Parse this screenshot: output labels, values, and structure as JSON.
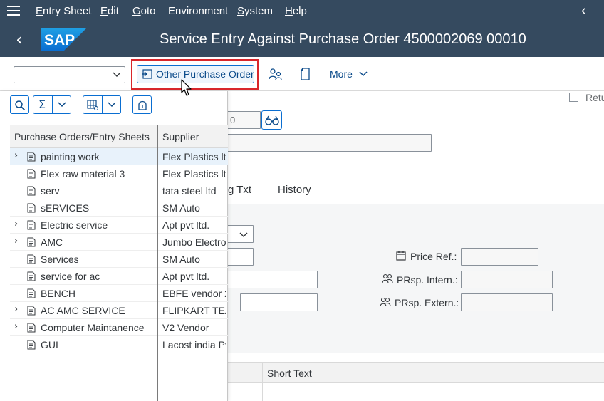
{
  "menubar": {
    "items": [
      {
        "first": "E",
        "rest": "ntry Sheet"
      },
      {
        "first": "E",
        "rest": "dit"
      },
      {
        "first": "G",
        "rest": "oto"
      },
      {
        "first": "",
        "rest": "Environment"
      },
      {
        "first": "S",
        "rest": "ystem"
      },
      {
        "first": "H",
        "rest": "elp"
      }
    ]
  },
  "titlebar": {
    "logo_text": "SAP",
    "title": "Service Entry Against Purchase Order 4500002069 00010"
  },
  "toolbar": {
    "command_value": "",
    "other_po_label": "Other Purchase Order",
    "more_label": "More"
  },
  "form": {
    "field_partial": "0",
    "returns_label": "Retu",
    "tabs": [
      "g Txt",
      "History"
    ],
    "price_ref_label": "Price Ref.:",
    "prsp_intern_label": "PRsp. Intern.:",
    "prsp_extern_label": "PRsp. Extern.:",
    "short_text_header": "Short Text"
  },
  "overlay": {
    "columns": [
      "Purchase Orders/Entry Sheets",
      "Supplier"
    ],
    "rows": [
      {
        "name": "painting work",
        "supplier": "Flex Plastics ltd",
        "expandable": true,
        "selected": true
      },
      {
        "name": "Flex raw material 3",
        "supplier": "Flex Plastics ltd",
        "expandable": false,
        "selected": false
      },
      {
        "name": "serv",
        "supplier": "tata steel ltd",
        "expandable": false,
        "selected": false
      },
      {
        "name": "sERVICES",
        "supplier": "SM Auto",
        "expandable": false,
        "selected": false
      },
      {
        "name": "Electric service",
        "supplier": "Apt pvt ltd.",
        "expandable": true,
        "selected": false
      },
      {
        "name": "AMC",
        "supplier": "Jumbo Electro",
        "expandable": true,
        "selected": false
      },
      {
        "name": "Services",
        "supplier": "SM Auto",
        "expandable": false,
        "selected": false
      },
      {
        "name": "service for ac",
        "supplier": "Apt pvt ltd.",
        "expandable": false,
        "selected": false
      },
      {
        "name": "BENCH",
        "supplier": "EBFE vendor 2",
        "expandable": false,
        "selected": false
      },
      {
        "name": "AC AMC SERVICE",
        "supplier": "FLIPKART TEA",
        "expandable": true,
        "selected": false
      },
      {
        "name": "Computer Maintanence",
        "supplier": "V2 Vendor",
        "expandable": true,
        "selected": false
      },
      {
        "name": "GUI",
        "supplier": "Lacost india Pv",
        "expandable": false,
        "selected": false
      }
    ]
  },
  "colors": {
    "shell": "#354a5f",
    "accent": "#0a6ed1",
    "highlight": "#d9262b"
  }
}
